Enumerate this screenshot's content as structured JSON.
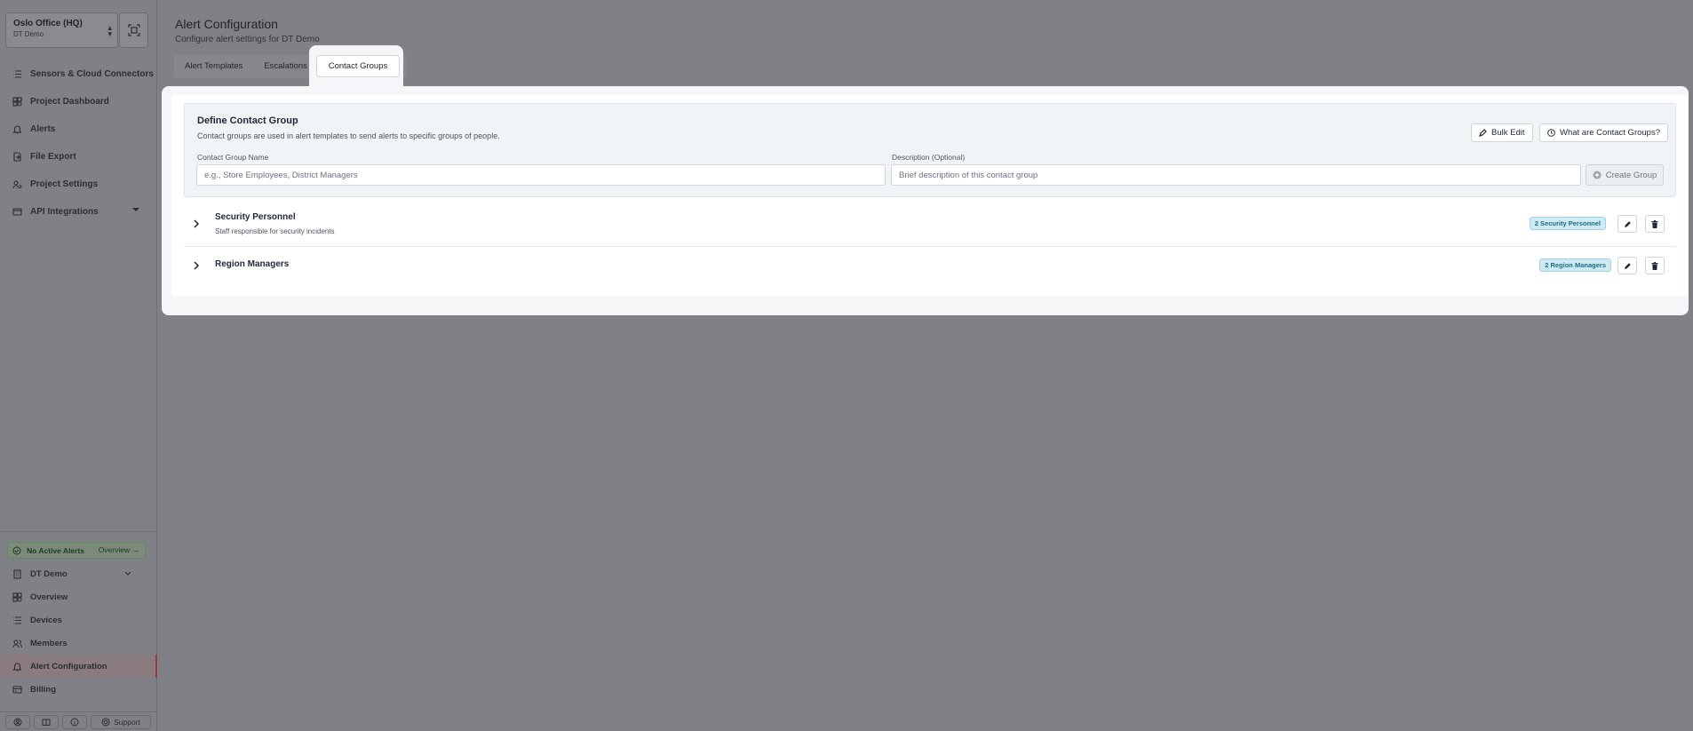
{
  "sidebar": {
    "org": {
      "name": "Oslo Office (HQ)",
      "subtitle": "DT Demo"
    },
    "nav": [
      {
        "label": "Sensors & Cloud Connectors",
        "icon": "list-icon"
      },
      {
        "label": "Project Dashboard",
        "icon": "dashboard-icon"
      },
      {
        "label": "Alerts",
        "icon": "bell-icon"
      },
      {
        "label": "File Export",
        "icon": "file-export-icon"
      },
      {
        "label": "Project Settings",
        "icon": "project-settings-icon"
      },
      {
        "label": "API Integrations",
        "icon": "api-icon"
      }
    ],
    "alert_status": {
      "label": "No Active Alerts",
      "link": "Overview"
    },
    "bottom_nav": [
      {
        "label": "DT Demo",
        "icon": "building-icon"
      },
      {
        "label": "Overview",
        "icon": "dashboard-icon"
      },
      {
        "label": "Devices",
        "icon": "list-icon"
      },
      {
        "label": "Members",
        "icon": "members-icon"
      },
      {
        "label": "Alert Configuration",
        "icon": "bell-icon",
        "active": true
      },
      {
        "label": "Billing",
        "icon": "billing-icon"
      }
    ],
    "footer": {
      "support_label": "Support"
    }
  },
  "header": {
    "title": "Alert Configuration",
    "subtitle": "Configure alert settings for DT Demo"
  },
  "tabs": {
    "alert_templates": "Alert Templates",
    "escalations": "Escalations",
    "contact_groups": "Contact Groups",
    "active": "contact_groups"
  },
  "define_group": {
    "title": "Define Contact Group",
    "description": "Contact groups are used in alert templates to send alerts to specific groups of people.",
    "bulk_edit_label": "Bulk Edit",
    "help_label": "What are Contact Groups?",
    "name_label": "Contact Group Name",
    "name_value": "",
    "name_placeholder": "e.g., Store Employees, District Managers",
    "desc_label": "Description (Optional)",
    "desc_value": "",
    "desc_placeholder": "Brief description of this contact group",
    "create_label": "Create Group"
  },
  "groups": [
    {
      "name": "Security Personnel",
      "description": "Staff responsible for security incidents",
      "badge": "2 Security Personnel"
    },
    {
      "name": "Region Managers",
      "description": "",
      "badge": "2 Region Managers"
    }
  ],
  "colors": {
    "accent_active": "#a1373a",
    "badge_bg": "#cfeaf3",
    "badge_text": "#1b6d86",
    "alert_ok": "#1d3d1f"
  }
}
